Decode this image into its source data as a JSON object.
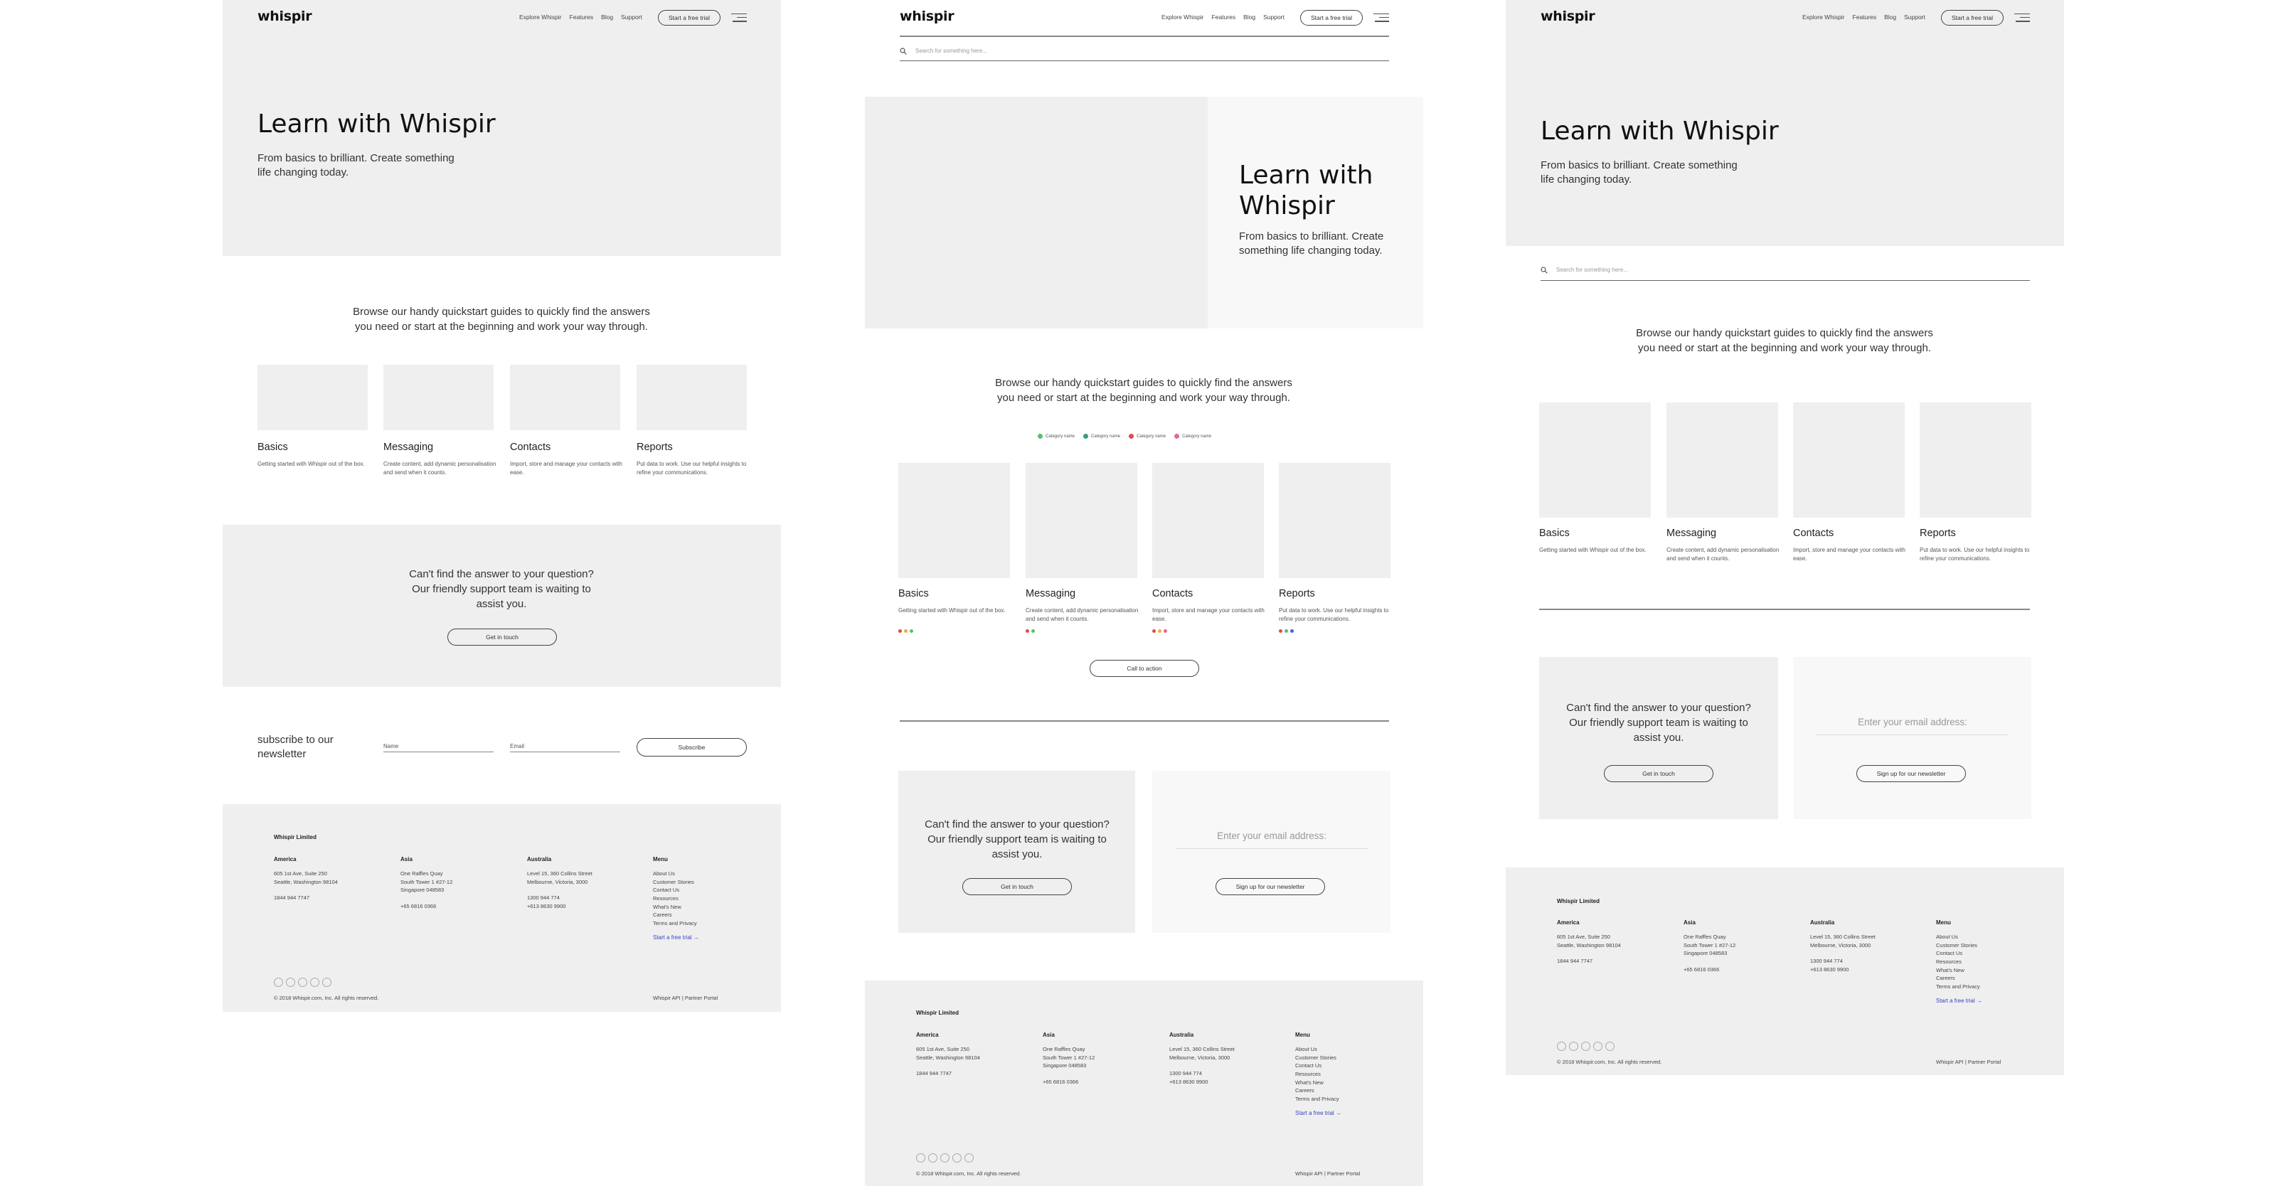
{
  "brand": {
    "logo": "whispir"
  },
  "nav": {
    "items": [
      "Explore Whispir",
      "Features",
      "Blog",
      "Support"
    ],
    "cta": "Start a free trial"
  },
  "search": {
    "placeholder": "Search for something here..."
  },
  "hero": {
    "title": "Learn with Whispir",
    "subtitle": "From basics to brilliant. Create something life changing today."
  },
  "intro": "Browse our handy quickstart guides to quickly find the answers you need or start at the beginning and work your way through.",
  "categories": [
    {
      "title": "Basics",
      "desc": "Getting started with Whispir out of the box."
    },
    {
      "title": "Messaging",
      "desc": "Create content, add dynamic personalisation and send when it counts."
    },
    {
      "title": "Contacts",
      "desc": "Import, store and manage your contacts with ease."
    },
    {
      "title": "Reports",
      "desc": "Put data to work. Use our helpful insights to refine your communications."
    }
  ],
  "chips": [
    "Category name",
    "Category name",
    "Category name",
    "Category name"
  ],
  "colors": {
    "chip_1": "#5bbf6a",
    "chip_2": "#3a9e7a",
    "chip_3": "#e04b4b",
    "chip_4": "#e06a8a",
    "dot_yellow": "#e8b23a",
    "dot_blue": "#3a6ad8",
    "link": "#3845c8"
  },
  "cta_button": "Call to action",
  "support": {
    "text": "Can't find the answer to your question? Our friendly support team is waiting to assist you.",
    "button": "Get in touch"
  },
  "newsletter_box": {
    "placeholder": "Enter your email address:",
    "button": "Sign up for our newsletter"
  },
  "subscribe": {
    "label": "subscribe to our newsletter",
    "name_label": "Name",
    "email_label": "Email",
    "button": "Subscribe"
  },
  "footer": {
    "company": "Whispir Limited",
    "columns": [
      {
        "heading": "America",
        "lines": [
          "605 1st Ave, Suite 250",
          "Seattle, Washington 98104",
          "",
          "1844 944 7747"
        ]
      },
      {
        "heading": "Asia",
        "lines": [
          "One Raffles Quay",
          "South Tower 1 #27-12",
          "Singapore 048583",
          "",
          "+65 6816 0366"
        ]
      },
      {
        "heading": "Australia",
        "lines": [
          "Level 15, 360 Collins Street",
          "Melbourne, Victoria, 3000",
          "",
          "1300 944 774",
          "+613 8630 9900"
        ]
      },
      {
        "heading": "Menu",
        "lines": [
          "About Us",
          "Customer Stories",
          "Contact Us",
          "Resources",
          "What's New",
          "Careers",
          "Terms and Privacy"
        ]
      }
    ],
    "trial_link": "Start a free trial →",
    "copyright": "© 2018 Whispir.com, Inc. All rights reserved.",
    "bottom_links": "Whispir API | Partner Portal",
    "social_icons": [
      "twitter-icon",
      "facebook-icon",
      "linkedin-icon",
      "youtube-icon",
      "instagram-icon"
    ]
  }
}
